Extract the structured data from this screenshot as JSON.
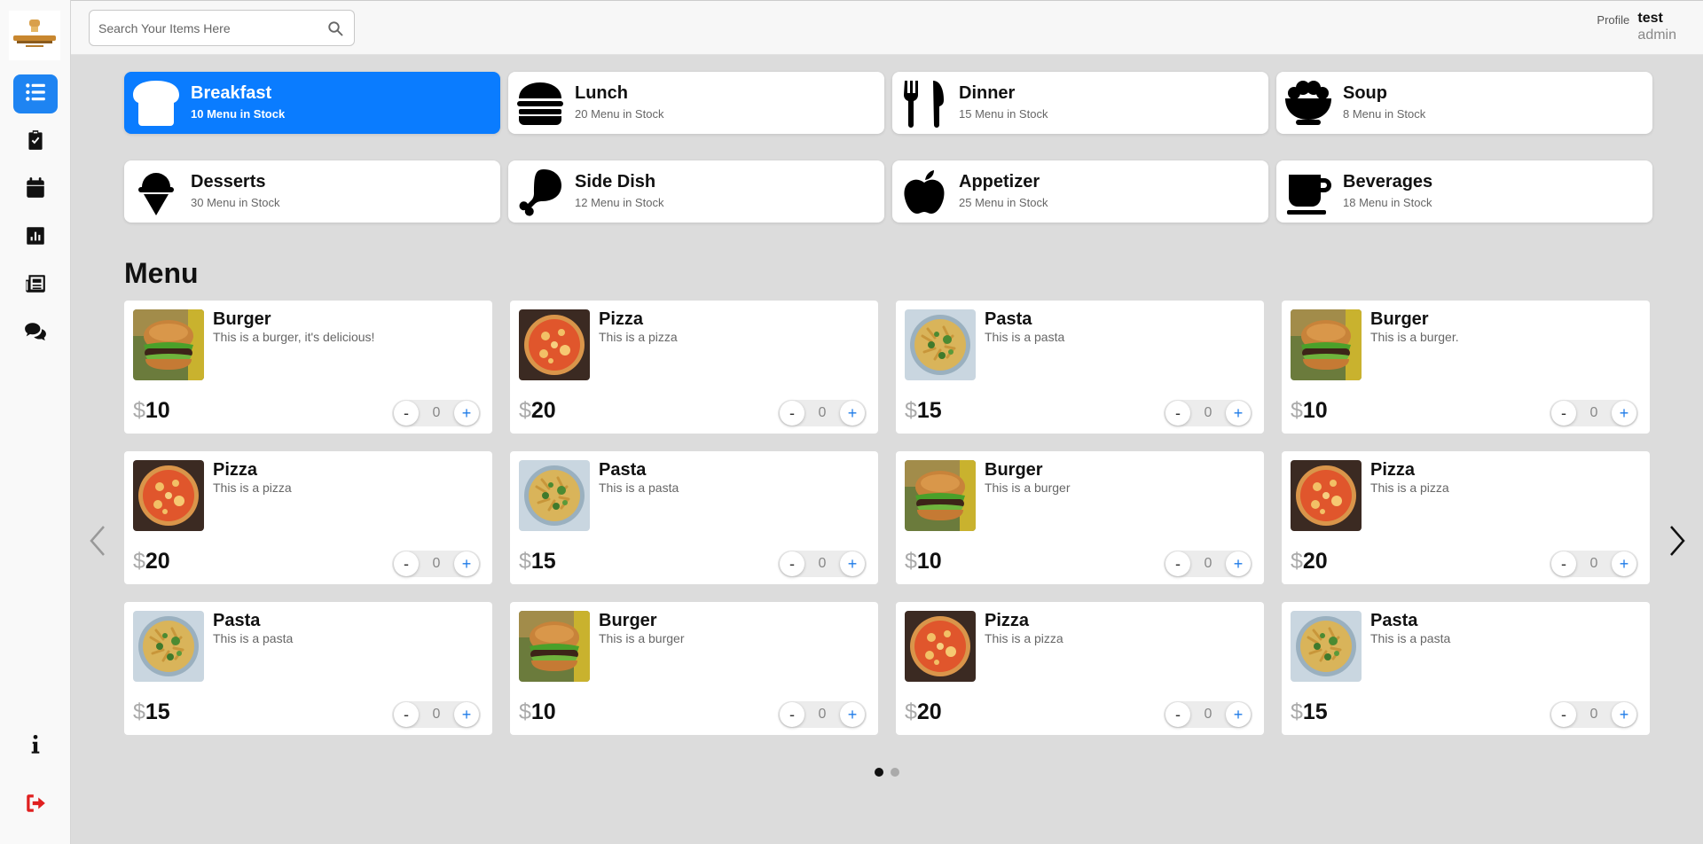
{
  "search": {
    "placeholder": "Search Your Items Here"
  },
  "profile": {
    "avatar_alt": "Profile",
    "name": "test",
    "role": "admin"
  },
  "sidebar": {
    "items": [
      {
        "icon": "list-icon",
        "active": true
      },
      {
        "icon": "clipboard-check-icon",
        "active": false
      },
      {
        "icon": "calendar-icon",
        "active": false
      },
      {
        "icon": "chart-icon",
        "active": false
      },
      {
        "icon": "newspaper-icon",
        "active": false
      },
      {
        "icon": "comments-icon",
        "active": false
      },
      {
        "icon": "info-icon",
        "active": false
      },
      {
        "icon": "logout-icon",
        "active": false,
        "color": "#e02020"
      }
    ]
  },
  "categories": [
    {
      "name": "Breakfast",
      "count": "10 Menu in Stock",
      "icon": "bread-icon",
      "active": true
    },
    {
      "name": "Lunch",
      "count": "20 Menu in Stock",
      "icon": "burger-icon",
      "active": false
    },
    {
      "name": "Dinner",
      "count": "15 Menu in Stock",
      "icon": "utensils-icon",
      "active": false
    },
    {
      "name": "Soup",
      "count": "8 Menu in Stock",
      "icon": "bowl-icon",
      "active": false
    },
    {
      "name": "Desserts",
      "count": "30 Menu in Stock",
      "icon": "ice-cream-icon",
      "active": false
    },
    {
      "name": "Side Dish",
      "count": "12 Menu in Stock",
      "icon": "drumstick-icon",
      "active": false
    },
    {
      "name": "Appetizer",
      "count": "25 Menu in Stock",
      "icon": "apple-icon",
      "active": false
    },
    {
      "name": "Beverages",
      "count": "18 Menu in Stock",
      "icon": "mug-icon",
      "active": false
    }
  ],
  "menu": {
    "title": "Menu",
    "currency": "$",
    "items": [
      {
        "name": "Burger",
        "desc": "This is a burger, it's delicious!",
        "price": "10",
        "qty": "0",
        "image": "burger"
      },
      {
        "name": "Pizza",
        "desc": "This is a pizza",
        "price": "20",
        "qty": "0",
        "image": "pizza"
      },
      {
        "name": "Pasta",
        "desc": "This is a pasta",
        "price": "15",
        "qty": "0",
        "image": "pasta"
      },
      {
        "name": "Burger",
        "desc": "This is a burger.",
        "price": "10",
        "qty": "0",
        "image": "burger"
      },
      {
        "name": "Pizza",
        "desc": "This is a pizza",
        "price": "20",
        "qty": "0",
        "image": "pizza"
      },
      {
        "name": "Pasta",
        "desc": "This is a pasta",
        "price": "15",
        "qty": "0",
        "image": "pasta"
      },
      {
        "name": "Burger",
        "desc": "This is a burger",
        "price": "10",
        "qty": "0",
        "image": "burger"
      },
      {
        "name": "Pizza",
        "desc": "This is a pizza",
        "price": "20",
        "qty": "0",
        "image": "pizza"
      },
      {
        "name": "Pasta",
        "desc": "This is a pasta",
        "price": "15",
        "qty": "0",
        "image": "pasta"
      },
      {
        "name": "Burger",
        "desc": "This is a burger",
        "price": "10",
        "qty": "0",
        "image": "burger"
      },
      {
        "name": "Pizza",
        "desc": "This is a pizza",
        "price": "20",
        "qty": "0",
        "image": "pizza"
      },
      {
        "name": "Pasta",
        "desc": "This is a pasta",
        "price": "15",
        "qty": "0",
        "image": "pasta"
      }
    ],
    "stepper": {
      "minus": "-",
      "plus": "+"
    }
  },
  "pagination": {
    "pages": 2,
    "current": 1
  },
  "colors": {
    "accent": "#0a7cff",
    "plus": "#1e7be8",
    "logout": "#e02020"
  }
}
